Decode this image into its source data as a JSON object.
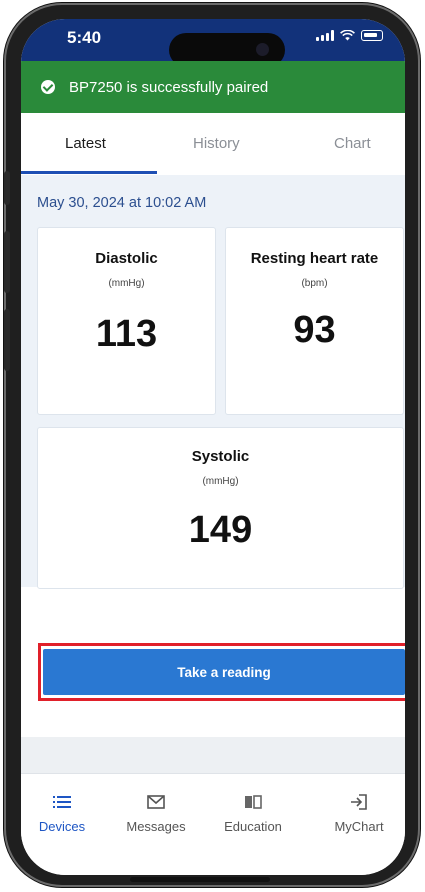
{
  "status_bar": {
    "time": "5:40"
  },
  "banner": {
    "message": "BP7250 is successfully paired",
    "color": "#2a8a3a"
  },
  "tabs": [
    {
      "label": "Latest",
      "active": true
    },
    {
      "label": "History",
      "active": false
    },
    {
      "label": "Chart",
      "active": false
    }
  ],
  "reading": {
    "datetime": "May 30, 2024 at 10:02 AM",
    "diastolic": {
      "label": "Diastolic",
      "unit": "(mmHg)",
      "value": "113"
    },
    "heart_rate": {
      "label": "Resting heart rate",
      "unit": "(bpm)",
      "value": "93"
    },
    "systolic": {
      "label": "Systolic",
      "unit": "(mmHg)",
      "value": "149"
    }
  },
  "actions": {
    "take_reading_label": "Take a reading",
    "button_color": "#2a78d2",
    "highlight_color": "#e0202a"
  },
  "bottom_nav": [
    {
      "label": "Devices",
      "icon": "list-icon",
      "active": true
    },
    {
      "label": "Messages",
      "icon": "envelope-icon",
      "active": false
    },
    {
      "label": "Education",
      "icon": "book-icon",
      "active": false
    },
    {
      "label": "MyChart",
      "icon": "sign-in-icon",
      "active": false
    }
  ],
  "theme": {
    "header_color": "#12327a",
    "accent": "#1e4fb4"
  }
}
